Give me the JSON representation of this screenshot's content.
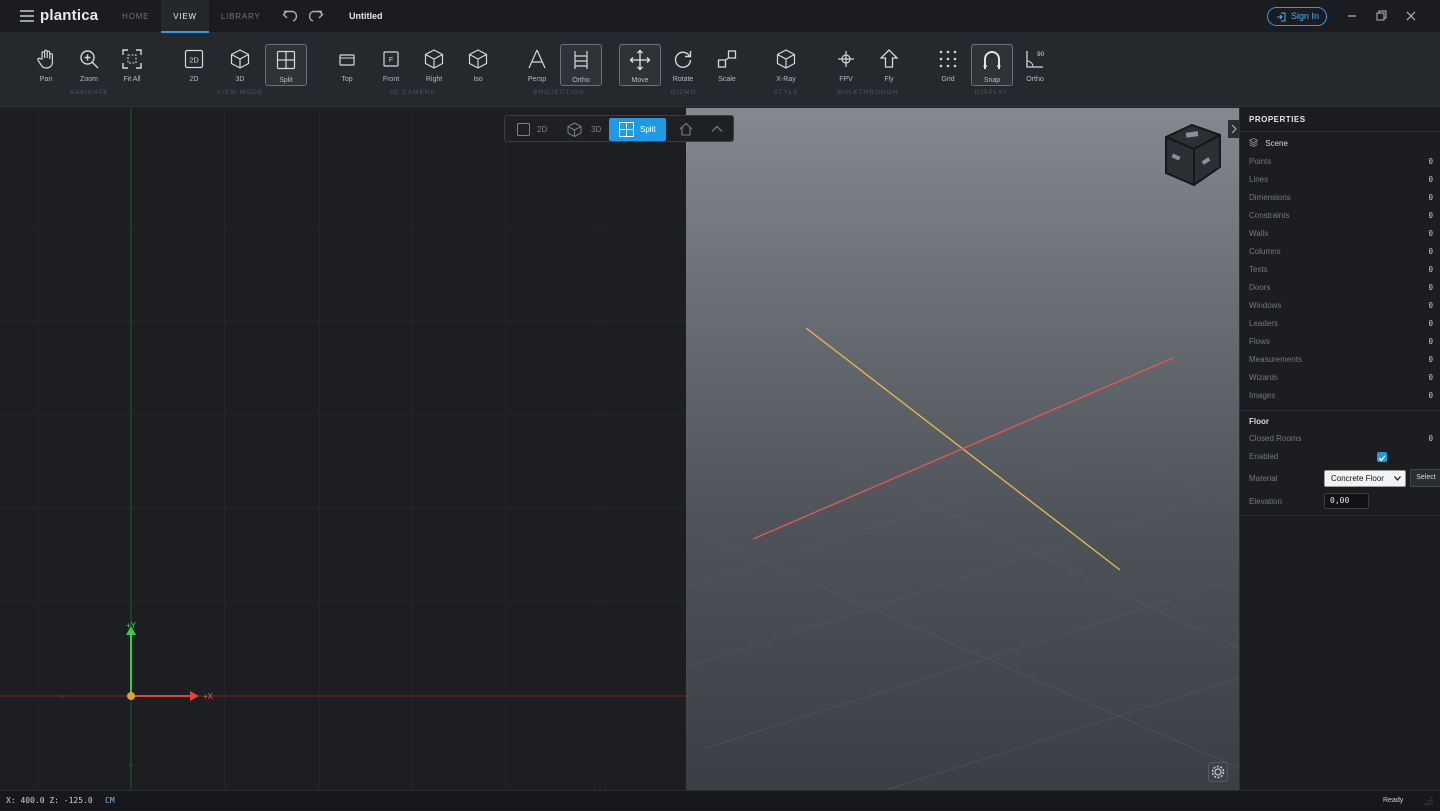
{
  "app": {
    "logo": "plantica",
    "doc_title": "Untitled"
  },
  "tabs": [
    {
      "label": "HOME",
      "active": false
    },
    {
      "label": "VIEW",
      "active": true
    },
    {
      "label": "LIBRARY",
      "active": false
    }
  ],
  "header": {
    "sign_in": "Sign In",
    "accent": "#2e9be6"
  },
  "ribbon": {
    "groups": {
      "navigate": "NAVIGATE",
      "view_mode": "VIEW MODE",
      "camera": "3D CAMERA",
      "projection": "PROJECTION",
      "gizmo": "GIZMO",
      "style": "STYLE",
      "walkthrough": "WALKTHROUGH",
      "display": "DISPLAY"
    },
    "tools": {
      "pan": "Pan",
      "zoom": "Zoom",
      "fit_all": "Fit All",
      "mode_2d": "2D",
      "mode_3d": "3D",
      "split": "Split",
      "top": "Top",
      "front": "Front",
      "right": "Right",
      "iso": "Iso",
      "persp": "Persp",
      "ortho": "Ortho",
      "move": "Move",
      "rotate": "Rotate",
      "scale": "Scale",
      "xray": "X-Ray",
      "fpv": "FPV",
      "fly": "Fly",
      "grid": "Grid",
      "snap": "Snap",
      "ortho_snap": "Ortho"
    },
    "icon_text": {
      "two_d": "2D",
      "front_f": "F",
      "ninety": "90"
    },
    "active_tools": [
      "Split",
      "Ortho",
      "Move",
      "Snap"
    ]
  },
  "view_switcher": {
    "opt_2d": "2D",
    "opt_3d": "3D",
    "opt_split": "Split",
    "active": "Split"
  },
  "view2d": {
    "axis_y_pos": "+Y",
    "axis_x_pos": "+X",
    "axis_x_neg": "-X",
    "axis_y_neg": "-Y"
  },
  "properties": {
    "title": "PROPERTIES",
    "scene_label": "Scene",
    "counts": [
      {
        "label": "Points",
        "value": "0"
      },
      {
        "label": "Lines",
        "value": "0"
      },
      {
        "label": "Dimensions",
        "value": "0"
      },
      {
        "label": "Constraints",
        "value": "0"
      },
      {
        "label": "Walls",
        "value": "0"
      },
      {
        "label": "Columns",
        "value": "0"
      },
      {
        "label": "Texts",
        "value": "0"
      },
      {
        "label": "Doors",
        "value": "0"
      },
      {
        "label": "Windows",
        "value": "0"
      },
      {
        "label": "Leaders",
        "value": "0"
      },
      {
        "label": "Flows",
        "value": "0"
      },
      {
        "label": "Measurements",
        "value": "0"
      },
      {
        "label": "Wizards",
        "value": "0"
      },
      {
        "label": "Images",
        "value": "0"
      }
    ],
    "floor": {
      "title": "Floor",
      "closed_rooms_label": "Closed Rooms",
      "closed_rooms_value": "0",
      "enabled_label": "Enabled",
      "enabled": true,
      "material_label": "Material",
      "material_value": "Concrete Floor",
      "material_button": "Select",
      "elevation_label": "Elevation",
      "elevation_value": "0,00"
    }
  },
  "status": {
    "coords": "X:  400.0  Z: -125.0",
    "unit": "CM",
    "state": "Ready"
  }
}
